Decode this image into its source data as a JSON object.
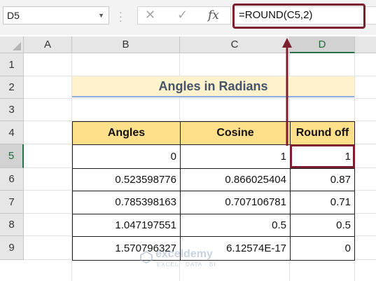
{
  "formula_bar": {
    "name_box": "D5",
    "cancel_icon": "✕",
    "enter_icon": "✓",
    "fx_label": "fx",
    "formula": "=ROUND(C5,2)"
  },
  "columns": [
    "A",
    "B",
    "C",
    "D"
  ],
  "rows": [
    "1",
    "2",
    "3",
    "4",
    "5",
    "6",
    "7",
    "8",
    "9"
  ],
  "title": "Angles in Radians",
  "table": {
    "headers": [
      "Angles",
      "Cosine",
      "Round off"
    ],
    "rows": [
      [
        "0",
        "1",
        "1"
      ],
      [
        "0.523598776",
        "0.866025404",
        "0.87"
      ],
      [
        "0.785398163",
        "0.707106781",
        "0.71"
      ],
      [
        "1.047197551",
        "0.5",
        "0.5"
      ],
      [
        "1.570796327",
        "6.12574E-17",
        "0"
      ]
    ]
  },
  "watermark": {
    "name": "exceldemy",
    "tagline": "EXCEL · DATA · BI"
  },
  "colors": {
    "highlight": "#7c1f2c",
    "header_fill": "#ffe08a",
    "title_fill": "#fff2cc",
    "title_text": "#44546a",
    "selection_green": "#217346"
  }
}
